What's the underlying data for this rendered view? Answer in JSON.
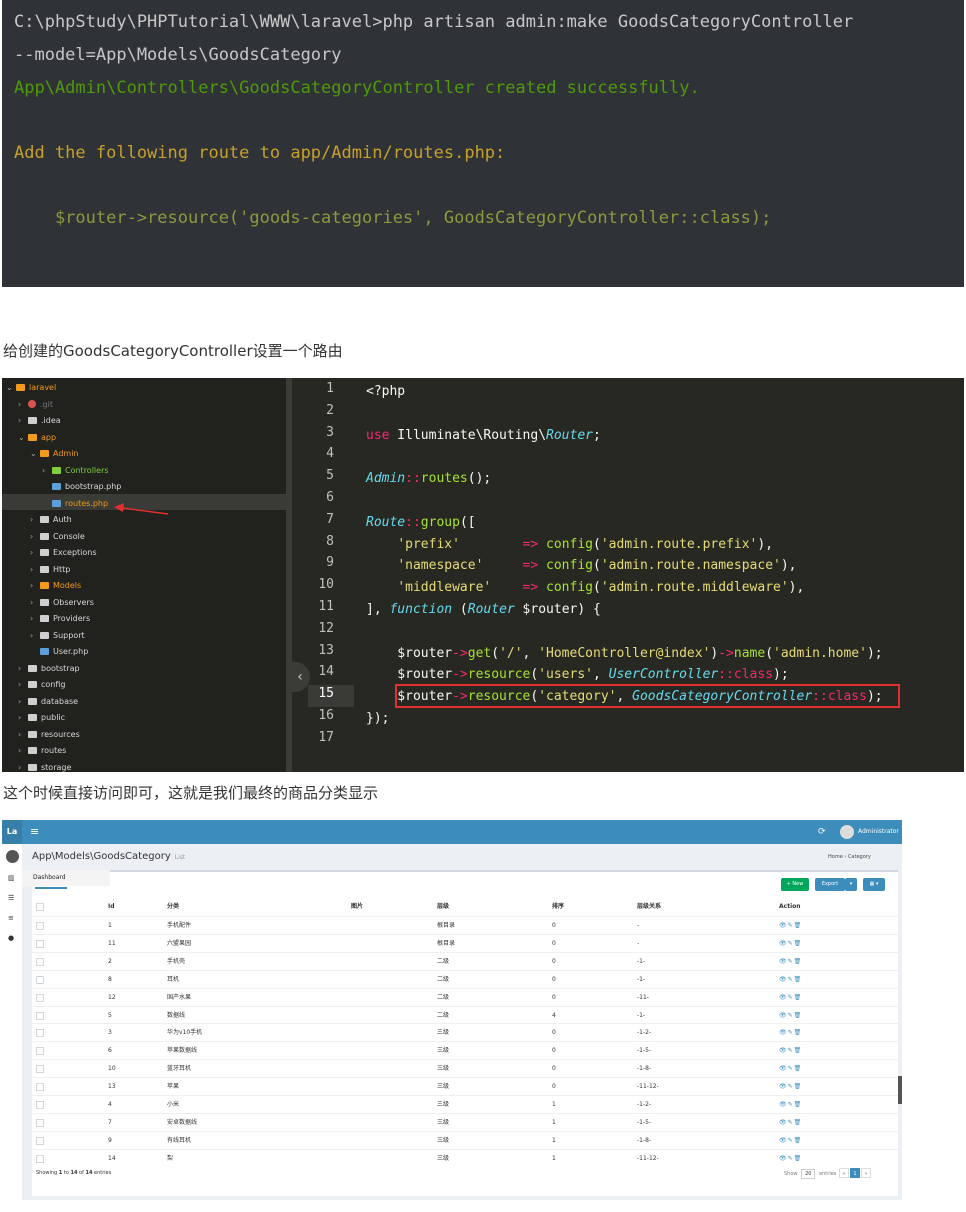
{
  "terminal": {
    "lines": [
      "C:\\phpStudy\\PHPTutorial\\WWW\\laravel>php artisan admin:make GoodsCategoryController",
      "--model=App\\Models\\GoodsCategory",
      "App\\Admin\\Controllers\\GoodsCategoryController created successfully.",
      "Add the following route to app/Admin/routes.php:",
      "    $router->resource('goods-categories', GoodsCategoryController::class);"
    ]
  },
  "captions": {
    "first": "给创建的GoodsCategoryController设置一个路由",
    "second": "这个时候直接访问即可，这就是我们最终的商品分类显示"
  },
  "editor": {
    "tree": [
      {
        "label": "laravel",
        "depth": 0,
        "type": "project"
      },
      {
        "label": ".git",
        "depth": 1,
        "type": "git"
      },
      {
        "label": ".idea",
        "depth": 1,
        "type": "folder"
      },
      {
        "label": "app",
        "depth": 1,
        "type": "folder-open"
      },
      {
        "label": "Admin",
        "depth": 2,
        "type": "folder-open"
      },
      {
        "label": "Controllers",
        "depth": 3,
        "type": "folder-green"
      },
      {
        "label": "bootstrap.php",
        "depth": 3,
        "type": "file"
      },
      {
        "label": "routes.php",
        "depth": 3,
        "type": "file-selected"
      },
      {
        "label": "Auth",
        "depth": 2,
        "type": "folder"
      },
      {
        "label": "Console",
        "depth": 2,
        "type": "folder"
      },
      {
        "label": "Exceptions",
        "depth": 2,
        "type": "folder"
      },
      {
        "label": "Http",
        "depth": 2,
        "type": "folder"
      },
      {
        "label": "Models",
        "depth": 2,
        "type": "folder-orange"
      },
      {
        "label": "Observers",
        "depth": 2,
        "type": "folder"
      },
      {
        "label": "Providers",
        "depth": 2,
        "type": "folder"
      },
      {
        "label": "Support",
        "depth": 2,
        "type": "folder"
      },
      {
        "label": "User.php",
        "depth": 2,
        "type": "file"
      },
      {
        "label": "bootstrap",
        "depth": 1,
        "type": "folder"
      },
      {
        "label": "config",
        "depth": 1,
        "type": "folder"
      },
      {
        "label": "database",
        "depth": 1,
        "type": "folder"
      },
      {
        "label": "public",
        "depth": 1,
        "type": "folder"
      },
      {
        "label": "resources",
        "depth": 1,
        "type": "folder"
      },
      {
        "label": "routes",
        "depth": 1,
        "type": "folder"
      },
      {
        "label": "storage",
        "depth": 1,
        "type": "folder"
      }
    ],
    "line_numbers": [
      "1",
      "2",
      "3",
      "4",
      "5",
      "6",
      "7",
      "8",
      "9",
      "10",
      "11",
      "12",
      "13",
      "14",
      "15",
      "16",
      "17"
    ],
    "active_line": "15",
    "collapse_label": "‹",
    "code": [
      [
        [
          "w",
          "<?php"
        ]
      ],
      [],
      [
        [
          "r",
          "use"
        ],
        [
          "w",
          " Illuminate\\Routing\\"
        ],
        [
          "b",
          "Router"
        ],
        [
          "w",
          ";"
        ]
      ],
      [],
      [
        [
          "b",
          "Admin"
        ],
        [
          "r",
          "::"
        ],
        [
          "g",
          "routes"
        ],
        [
          "w",
          "();"
        ]
      ],
      [],
      [
        [
          "b",
          "Route"
        ],
        [
          "r",
          "::"
        ],
        [
          "g",
          "group"
        ],
        [
          "w",
          "(["
        ]
      ],
      [
        [
          "w",
          "    "
        ],
        [
          "s",
          "'prefix'"
        ],
        [
          "w",
          "        "
        ],
        [
          "r",
          "=>"
        ],
        [
          "w",
          " "
        ],
        [
          "g",
          "config"
        ],
        [
          "w",
          "("
        ],
        [
          "s",
          "'admin.route.prefix'"
        ],
        [
          "w",
          "),"
        ]
      ],
      [
        [
          "w",
          "    "
        ],
        [
          "s",
          "'namespace'"
        ],
        [
          "w",
          "     "
        ],
        [
          "r",
          "=>"
        ],
        [
          "w",
          " "
        ],
        [
          "g",
          "config"
        ],
        [
          "w",
          "("
        ],
        [
          "s",
          "'admin.route.namespace'"
        ],
        [
          "w",
          "),"
        ]
      ],
      [
        [
          "w",
          "    "
        ],
        [
          "s",
          "'middleware'"
        ],
        [
          "w",
          "    "
        ],
        [
          "r",
          "=>"
        ],
        [
          "w",
          " "
        ],
        [
          "g",
          "config"
        ],
        [
          "w",
          "("
        ],
        [
          "s",
          "'admin.route.middleware'"
        ],
        [
          "w",
          "),"
        ]
      ],
      [
        [
          "w",
          "], "
        ],
        [
          "b",
          "function"
        ],
        [
          "w",
          " ("
        ],
        [
          "b",
          "Router"
        ],
        [
          "w",
          " $router) {"
        ]
      ],
      [],
      [
        [
          "w",
          "    $router"
        ],
        [
          "r",
          "->"
        ],
        [
          "g",
          "get"
        ],
        [
          "w",
          "("
        ],
        [
          "s",
          "'/'"
        ],
        [
          "w",
          ", "
        ],
        [
          "s",
          "'HomeController@index'"
        ],
        [
          "w",
          ")"
        ],
        [
          "r",
          "->"
        ],
        [
          "g",
          "name"
        ],
        [
          "w",
          "("
        ],
        [
          "s",
          "'admin.home'"
        ],
        [
          "w",
          ");"
        ]
      ],
      [
        [
          "w",
          "    $router"
        ],
        [
          "r",
          "->"
        ],
        [
          "g",
          "resource"
        ],
        [
          "w",
          "("
        ],
        [
          "s",
          "'users'"
        ],
        [
          "w",
          ", "
        ],
        [
          "b",
          "UserController"
        ],
        [
          "r",
          "::"
        ],
        [
          "r",
          "class"
        ],
        [
          "w",
          ");"
        ]
      ],
      [
        [
          "w",
          "    $router"
        ],
        [
          "r",
          "->"
        ],
        [
          "g",
          "resource"
        ],
        [
          "w",
          "("
        ],
        [
          "s",
          "'category'"
        ],
        [
          "w",
          ", "
        ],
        [
          "b",
          "GoodsCategoryController"
        ],
        [
          "r",
          "::"
        ],
        [
          "r",
          "class"
        ],
        [
          "w",
          ");"
        ]
      ],
      [
        [
          "w",
          "});"
        ]
      ],
      []
    ]
  },
  "admin": {
    "logo": "La",
    "menu_icon": "≡",
    "refresh_icon": "⟳",
    "user_name": "Administrator",
    "sidebar_icons": [
      "▥",
      "☰",
      "≡",
      "●"
    ],
    "tooltip": "Dashboard",
    "title": "App\\Models\\GoodsCategory",
    "subtitle": "List",
    "breadcrumb": "Home  ›  Category",
    "buttons": {
      "new": "+ New",
      "export": "Export",
      "export_caret": "▾",
      "columns": "▦ ▾"
    },
    "columns": [
      "Id",
      "分类",
      "图片",
      "层级",
      "排序",
      "层级关系",
      "Action"
    ],
    "rows": [
      {
        "id": "1",
        "name": "手机配件",
        "level": "根目录",
        "order": "0",
        "rel": "-"
      },
      {
        "id": "11",
        "name": "六盟果园",
        "level": "根目录",
        "order": "0",
        "rel": "-"
      },
      {
        "id": "2",
        "name": "手机壳",
        "level": "二级",
        "order": "0",
        "rel": "-1-"
      },
      {
        "id": "8",
        "name": "耳机",
        "level": "二级",
        "order": "0",
        "rel": "-1-"
      },
      {
        "id": "12",
        "name": "国产水果",
        "level": "二级",
        "order": "0",
        "rel": "-11-"
      },
      {
        "id": "5",
        "name": "数据线",
        "level": "二级",
        "order": "4",
        "rel": "-1-"
      },
      {
        "id": "3",
        "name": "华为v10手机",
        "level": "三级",
        "order": "0",
        "rel": "-1-2-"
      },
      {
        "id": "6",
        "name": "苹果数据线",
        "level": "三级",
        "order": "0",
        "rel": "-1-5-"
      },
      {
        "id": "10",
        "name": "蓝牙耳机",
        "level": "三级",
        "order": "0",
        "rel": "-1-8-"
      },
      {
        "id": "13",
        "name": "苹果",
        "level": "三级",
        "order": "0",
        "rel": "-11-12-"
      },
      {
        "id": "4",
        "name": "小米",
        "level": "三级",
        "order": "1",
        "rel": "-1-2-"
      },
      {
        "id": "7",
        "name": "安卓数据线",
        "level": "三级",
        "order": "1",
        "rel": "-1-5-"
      },
      {
        "id": "9",
        "name": "有线耳机",
        "level": "三级",
        "order": "1",
        "rel": "-1-8-"
      },
      {
        "id": "14",
        "name": "梨",
        "level": "三级",
        "order": "1",
        "rel": "-11-12-"
      }
    ],
    "action_icons": "👁✎🗑",
    "footer_prefix": "Showing ",
    "footer_from": "1",
    "footer_mid1": " to ",
    "footer_to": "14",
    "footer_mid2": " of ",
    "footer_total": "14",
    "footer_suffix": " entries",
    "pager_show": "Show",
    "pager_size": "20",
    "pager_entries": "entries",
    "pager_prev": "«",
    "pager_page": "1",
    "pager_next": "»"
  }
}
